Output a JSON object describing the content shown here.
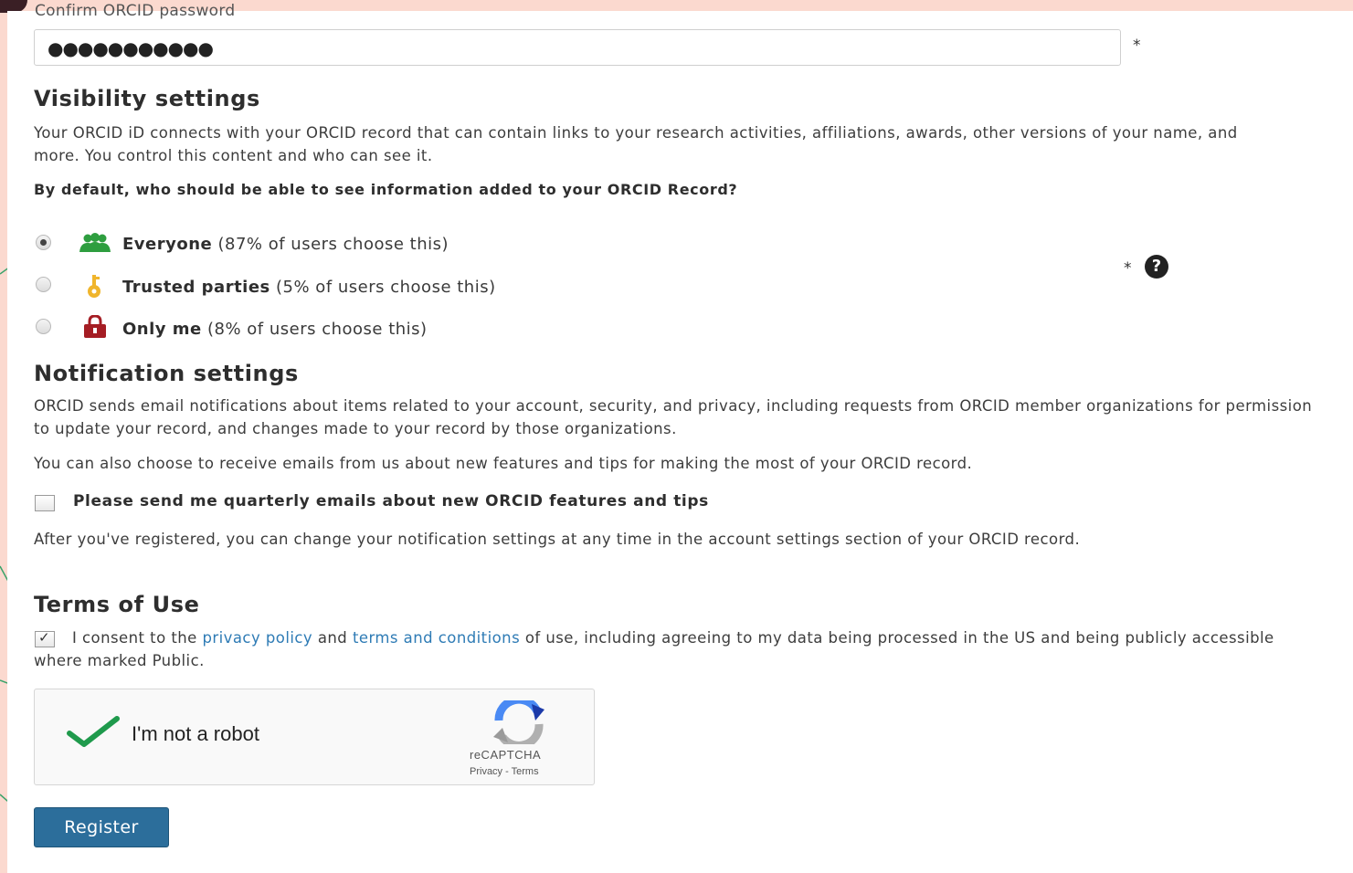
{
  "password": {
    "label": "Confirm ORCID password",
    "value": "●●●●●●●●●●●",
    "required_mark": "*"
  },
  "visibility": {
    "heading": "Visibility settings",
    "description": "Your ORCID iD connects with your ORCID record that can contain links to your research activities, affiliations, awards, other versions of your name, and more. You control this content and who can see it.",
    "question": "By default, who should be able to see information added to your ORCID Record?",
    "options": [
      {
        "label": "Everyone",
        "note": " (87% of users choose this)",
        "icon": "people-icon",
        "checked": true,
        "color": "#2e9e3f"
      },
      {
        "label": "Trusted parties",
        "note": " (5% of users choose this)",
        "icon": "key-icon",
        "checked": false,
        "color": "#f0b52c"
      },
      {
        "label": "Only me",
        "note": " (8% of users choose this)",
        "icon": "lock-icon",
        "checked": false,
        "color": "#a51d24"
      }
    ],
    "required_mark": "*",
    "help_icon": "question-icon",
    "help_glyph": "?"
  },
  "notifications": {
    "heading": "Notification settings",
    "description1": "ORCID sends email notifications about items related to your account, security, and privacy, including requests from ORCID member organizations for permission to update your record, and changes made to your record by those organizations.",
    "description2": "You can also choose to receive emails from us about new features and tips for making the most of your ORCID record.",
    "checkbox_label": "Please send me quarterly emails about new ORCID features and tips",
    "checkbox_checked": false,
    "after_text": "After you've registered, you can change your notification settings at any time in the account settings section of your ORCID record."
  },
  "terms": {
    "heading": "Terms of Use",
    "consent_prefix": "I consent to the ",
    "privacy_link": "privacy policy",
    "and_text": " and ",
    "terms_link": "terms and conditions",
    "consent_suffix": " of use, including agreeing to my data being processed in the US and being publicly accessible where marked Public.",
    "checked": true
  },
  "recaptcha": {
    "label": "I'm not a robot",
    "brand": "reCAPTCHA",
    "terms": "Privacy - Terms"
  },
  "register_label": "Register",
  "colors": {
    "link": "#2e7bb5",
    "button": "#2c6e9b",
    "check_green": "#1f9a4c",
    "annotation_line": "#3aa36b"
  }
}
